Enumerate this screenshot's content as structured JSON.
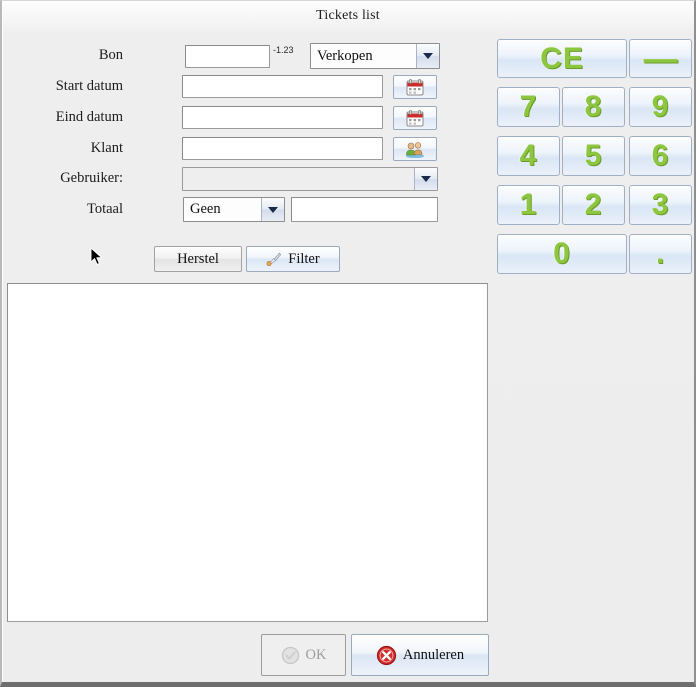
{
  "window": {
    "title": "Tickets list"
  },
  "form": {
    "fields": [
      {
        "label": "Bon",
        "value": "",
        "placeholder": ""
      },
      {
        "label": "Start datum",
        "value": "",
        "placeholder": ""
      },
      {
        "label": "Eind datum",
        "value": "",
        "placeholder": ""
      },
      {
        "label": "Klant",
        "value": "",
        "placeholder": ""
      },
      {
        "label": "Gebruiker:",
        "value": "",
        "placeholder": ""
      },
      {
        "label": "Totaal",
        "value": "",
        "placeholder": ""
      }
    ],
    "bon_hint": "-1.23",
    "type_combo": {
      "selected": "Verkopen",
      "options": [
        "Verkopen"
      ]
    },
    "gebruiker_combo": {
      "selected": "",
      "options": []
    },
    "totaal_combo": {
      "selected": "Geen",
      "options": [
        "Geen"
      ]
    },
    "totaal_value": ""
  },
  "icons": {
    "start_date": "calendar-icon",
    "end_date": "calendar-icon",
    "klant": "people-icon",
    "filter": "broom-icon",
    "ok": "check-circle-icon",
    "cancel": "error-circle-icon"
  },
  "actions": {
    "reset_label": "Herstel",
    "filter_label": "Filter",
    "ok_label": "OK",
    "cancel_label": "Annuleren"
  },
  "keypad": {
    "clear_label": "CE",
    "minus_label": "—",
    "keys": [
      "7",
      "8",
      "9",
      "4",
      "5",
      "6",
      "1",
      "2",
      "3"
    ],
    "zero_label": "0",
    "dot_label": "."
  },
  "colors": {
    "key_green": "#8dc63f",
    "cancel_red": "#cc2222",
    "window_bg": "#ededed",
    "list_bg": "#ffffff"
  },
  "list": {
    "rows": []
  }
}
